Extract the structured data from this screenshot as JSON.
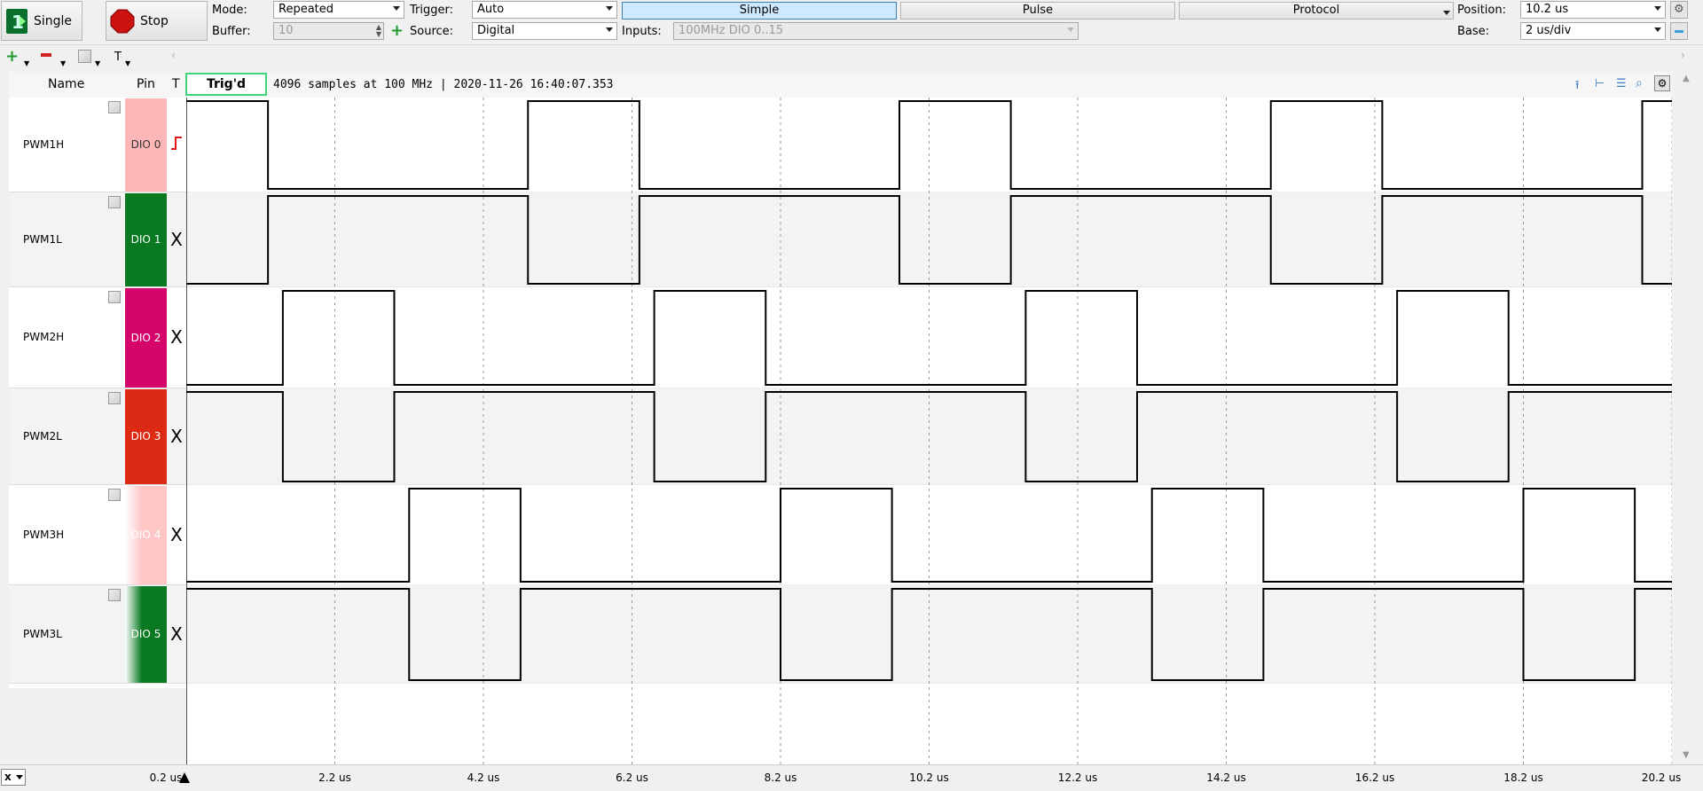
{
  "toolbar": {
    "single_label": "Single",
    "stop_label": "Stop",
    "mode_label": "Mode:",
    "mode_value": "Repeated",
    "buffer_label": "Buffer:",
    "buffer_value": "10",
    "trigger_label": "Trigger:",
    "trigger_value": "Auto",
    "source_label": "Source:",
    "source_value": "Digital",
    "inputs_label": "Inputs:",
    "inputs_value": "100MHz DIO 0..15",
    "tabs": [
      "Simple",
      "Pulse",
      "Protocol"
    ],
    "active_tab": "Simple",
    "position_label": "Position:",
    "position_value": "10.2 us",
    "base_label": "Base:",
    "base_value": "2 us/div"
  },
  "toolbar2": {
    "type_label": "T"
  },
  "header": {
    "name_col": "Name",
    "pin_col": "Pin",
    "t_col": "T",
    "status": "Trig'd",
    "info": "4096 samples at 100 MHz | 2020-11-26 16:40:07.353"
  },
  "channels": [
    {
      "name": "PWM1H",
      "pin": "DIO  0",
      "trigger": "rise",
      "color": "#ffb6b6",
      "edges": [
        0,
        1.3,
        4.8,
        6.3,
        9.8,
        11.3,
        14.8,
        16.3,
        19.8
      ],
      "start": 1
    },
    {
      "name": "PWM1L",
      "pin": "DIO  1",
      "trigger": "X",
      "color": "#0a7a22",
      "edges": [
        0,
        1.3,
        4.8,
        6.3,
        9.8,
        11.3,
        14.8,
        16.3,
        19.8
      ],
      "start": 0
    },
    {
      "name": "PWM2H",
      "pin": "DIO  2",
      "trigger": "X",
      "color": "#d4046b",
      "edges": [
        0,
        1.5,
        3.0,
        6.5,
        8.0,
        11.5,
        13.0,
        16.5,
        18.0
      ],
      "start": 0
    },
    {
      "name": "PWM2L",
      "pin": "DIO  3",
      "trigger": "X",
      "color": "#dc2a14",
      "edges": [
        0,
        1.5,
        3.0,
        6.5,
        8.0,
        11.5,
        13.0,
        16.5,
        18.0
      ],
      "start": 1
    },
    {
      "name": "PWM3H",
      "pin": "DIO  4",
      "trigger": "X",
      "color": "#ffc6c6",
      "edges": [
        0,
        3.2,
        4.7,
        8.2,
        9.7,
        13.2,
        14.7,
        18.2,
        19.7
      ],
      "start": 0
    },
    {
      "name": "PWM3L",
      "pin": "DIO  5",
      "trigger": "X",
      "color": "#0a7a22",
      "edges": [
        0,
        3.2,
        4.7,
        8.2,
        9.7,
        13.2,
        14.7,
        18.2,
        19.7
      ],
      "start": 1
    }
  ],
  "timeline": {
    "start_us": 0.2,
    "end_us": 20.2,
    "ticks": [
      "0.2 us",
      "2.2 us",
      "4.2 us",
      "6.2 us",
      "8.2 us",
      "10.2 us",
      "12.2 us",
      "14.2 us",
      "16.2 us",
      "18.2 us",
      "20.2 us"
    ],
    "bottom_button": "x"
  }
}
